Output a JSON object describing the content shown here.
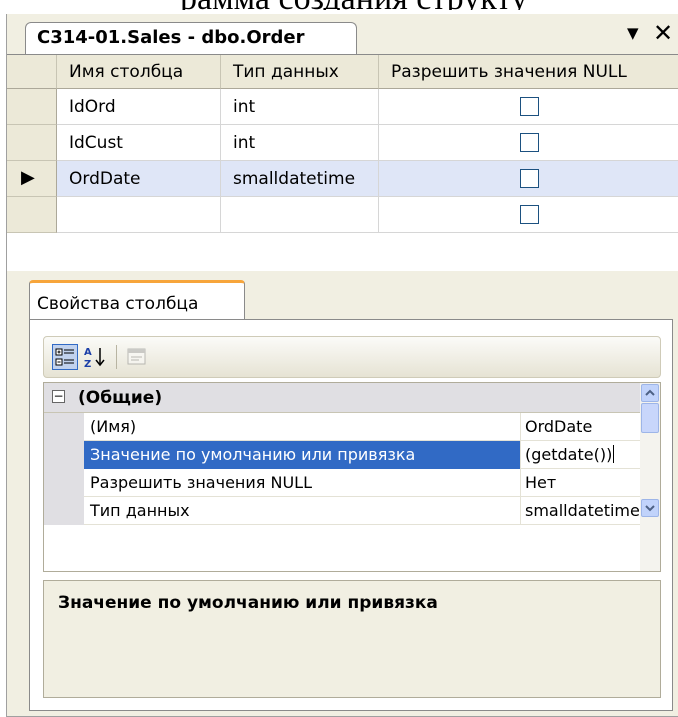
{
  "top_text": "рамма создания структу",
  "tab": {
    "title": "C314-01.Sales - dbo.Order",
    "dropdown_icon": "chevron-down-icon",
    "close_icon": "close-icon"
  },
  "grid": {
    "columns": [
      "Имя столбца",
      "Тип данных",
      "Разрешить значения NULL"
    ],
    "rows": [
      {
        "name": "IdOrd",
        "type": "int",
        "allow_null": false,
        "selected": false
      },
      {
        "name": "IdCust",
        "type": "int",
        "allow_null": false,
        "selected": false
      },
      {
        "name": "OrdDate",
        "type": "smalldatetime",
        "allow_null": false,
        "selected": true
      },
      {
        "name": "",
        "type": "",
        "allow_null": false,
        "selected": false
      }
    ]
  },
  "properties": {
    "tab_label": "Свойства столбца",
    "category": "(Общие)",
    "items": [
      {
        "name": "(Имя)",
        "value": "OrdDate"
      },
      {
        "name": "Значение по умолчанию или привязка",
        "value": "(getdate())"
      },
      {
        "name": "Разрешить значения NULL",
        "value": "Нет"
      },
      {
        "name": "Тип данных",
        "value": "smalldatetime"
      }
    ],
    "description_title": "Значение по умолчанию или привязка"
  },
  "colors": {
    "selection": "#316ac5",
    "row_selected": "#dfe6f7",
    "tab_accent": "#f7a53b"
  }
}
